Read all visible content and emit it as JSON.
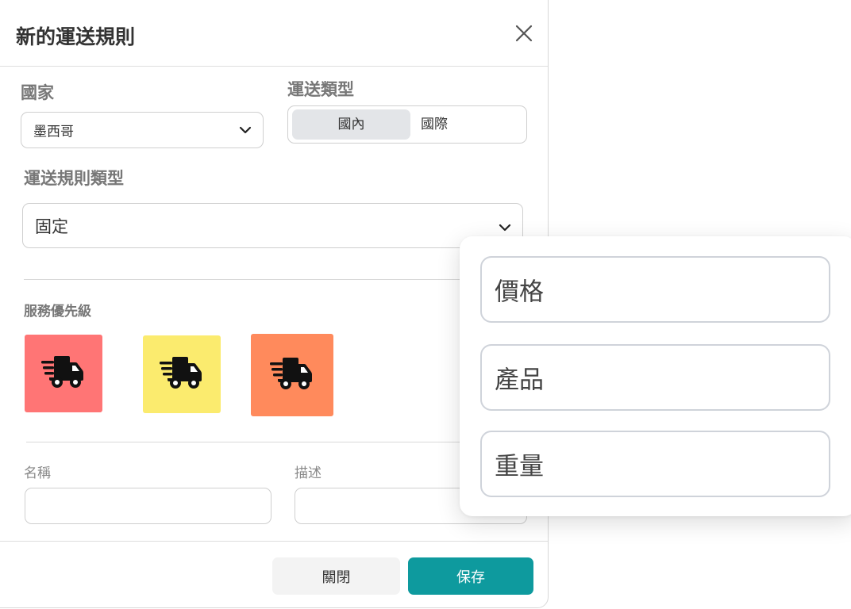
{
  "modal": {
    "title": "新的運送規則",
    "country_label": "國家",
    "country_value": "墨西哥",
    "shipping_type_label": "運送類型",
    "shipping_type_options": [
      "國內",
      "國際"
    ],
    "shipping_type_selected": "國內",
    "rule_type_label": "運送規則類型",
    "rule_type_value": "固定",
    "priority_label": "服務優先級",
    "priority_tiles": [
      {
        "color": "#ff7575",
        "icon": "fast-truck-icon"
      },
      {
        "color": "#fbeb6e",
        "icon": "fast-truck-icon"
      },
      {
        "color": "#ff8a5c",
        "icon": "fast-truck-icon"
      }
    ],
    "name_label": "名稱",
    "description_label": "描述",
    "name_value": "",
    "description_value": "",
    "close_label": "關閉",
    "save_label": "保存",
    "accent_color": "#0e9a9e"
  },
  "dropdown": {
    "options": [
      "價格",
      "產品",
      "重量"
    ]
  }
}
